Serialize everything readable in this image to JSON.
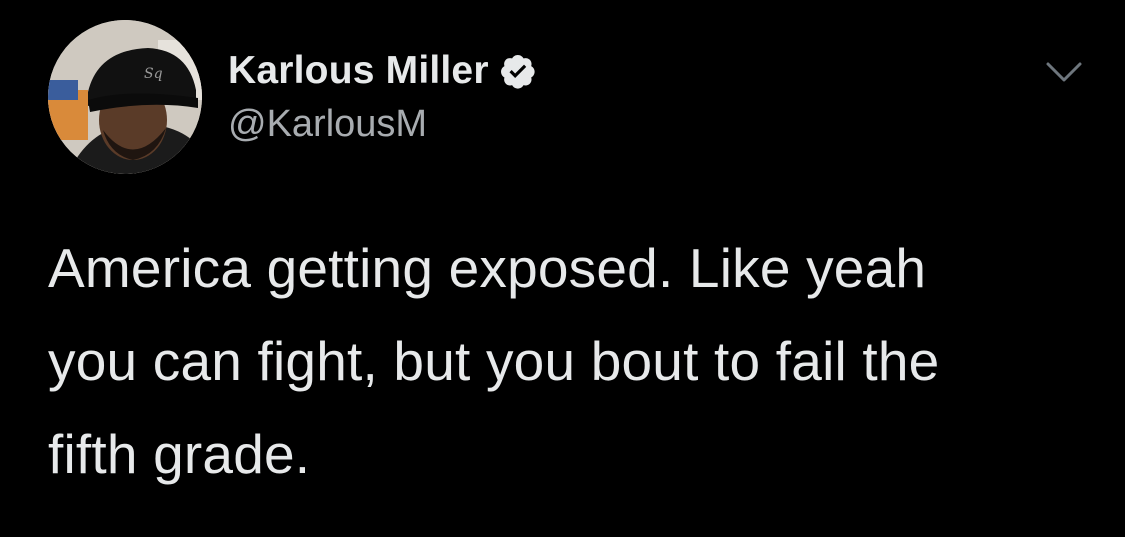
{
  "tweet": {
    "author": {
      "display_name": "Karlous Miller",
      "handle": "@KarlousM",
      "verified": true,
      "verified_icon": "verified-badge-icon",
      "avatar_icon": "avatar-photo"
    },
    "menu_icon": "chevron-down-icon",
    "text_lines": [
      "America getting exposed. Like yeah",
      "you can fight, but you bout to fail the",
      "fifth grade."
    ]
  },
  "colors": {
    "background": "#000000",
    "primary_text": "#e7e9ea",
    "secondary_text": "#a8acb0",
    "icon_gray": "#6e767d"
  }
}
